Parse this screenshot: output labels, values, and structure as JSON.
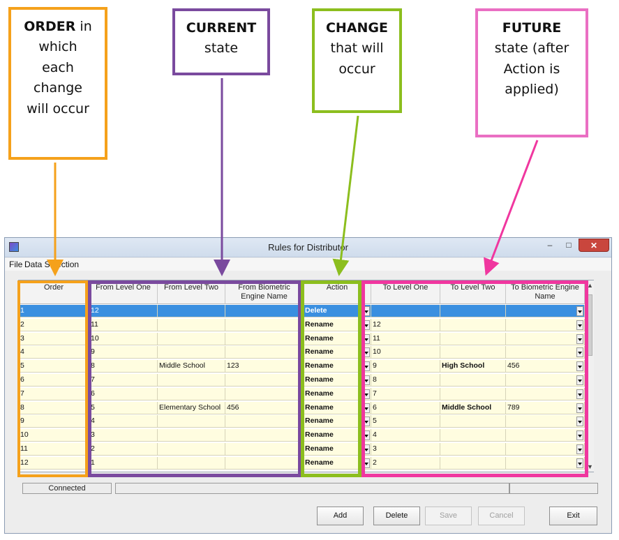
{
  "callouts": {
    "order": {
      "bold": "ORDER",
      "rest1": " in",
      "line2": "which",
      "line3": "each",
      "line4": "change",
      "line5": "will occur"
    },
    "current": {
      "bold": "CURRENT",
      "line2": "state"
    },
    "change": {
      "bold": "CHANGE",
      "line2": "that will",
      "line3": "occur"
    },
    "future": {
      "bold": "FUTURE",
      "line2": "state (after",
      "line3": "Action is",
      "line4": "applied)"
    }
  },
  "window": {
    "title": "Rules for Distributor",
    "minimize_glyph": "–",
    "maximize_glyph": "□",
    "close_glyph": "✕"
  },
  "menu": {
    "file": "File",
    "data_selection": "Data Selection"
  },
  "columns": {
    "order": "Order",
    "from_level_one": "From Level One",
    "from_level_two": "From Level Two",
    "from_biometric": "From Biometric Engine Name",
    "action": "Action",
    "to_level_one": "To Level One",
    "to_level_two": "To Level Two",
    "to_biometric": "To Biometric Engine Name"
  },
  "rows": [
    {
      "order": "1",
      "from1": "12",
      "from2": "",
      "from3": "",
      "action": "Delete",
      "to1": "",
      "to2": "",
      "to3": ""
    },
    {
      "order": "2",
      "from1": "11",
      "from2": "",
      "from3": "",
      "action": "Rename",
      "to1": "12",
      "to2": "",
      "to3": ""
    },
    {
      "order": "3",
      "from1": "10",
      "from2": "",
      "from3": "",
      "action": "Rename",
      "to1": "11",
      "to2": "",
      "to3": ""
    },
    {
      "order": "4",
      "from1": "9",
      "from2": "",
      "from3": "",
      "action": "Rename",
      "to1": "10",
      "to2": "",
      "to3": ""
    },
    {
      "order": "5",
      "from1": "8",
      "from2": "Middle School",
      "from3": "123",
      "action": "Rename",
      "to1": "9",
      "to2": "High School",
      "to3": "456"
    },
    {
      "order": "6",
      "from1": "7",
      "from2": "",
      "from3": "",
      "action": "Rename",
      "to1": "8",
      "to2": "",
      "to3": ""
    },
    {
      "order": "7",
      "from1": "6",
      "from2": "",
      "from3": "",
      "action": "Rename",
      "to1": "7",
      "to2": "",
      "to3": ""
    },
    {
      "order": "8",
      "from1": "5",
      "from2": "Elementary School",
      "from3": "456",
      "action": "Rename",
      "to1": "6",
      "to2": "Middle School",
      "to3": "789"
    },
    {
      "order": "9",
      "from1": "4",
      "from2": "",
      "from3": "",
      "action": "Rename",
      "to1": "5",
      "to2": "",
      "to3": ""
    },
    {
      "order": "10",
      "from1": "3",
      "from2": "",
      "from3": "",
      "action": "Rename",
      "to1": "4",
      "to2": "",
      "to3": ""
    },
    {
      "order": "11",
      "from1": "2",
      "from2": "",
      "from3": "",
      "action": "Rename",
      "to1": "3",
      "to2": "",
      "to3": ""
    },
    {
      "order": "12",
      "from1": "1",
      "from2": "",
      "from3": "",
      "action": "Rename",
      "to1": "2",
      "to2": "",
      "to3": ""
    }
  ],
  "status": {
    "connection": "Connected"
  },
  "buttons": {
    "add": "Add",
    "delete": "Delete",
    "save": "Save",
    "cancel": "Cancel",
    "exit": "Exit"
  },
  "colors": {
    "order": "#f5a11b",
    "current": "#7a4a9e",
    "change": "#8cbe1e",
    "future": "#f0379f",
    "selected_row": "#3a8fe0",
    "cell_bg": "#fffde0"
  }
}
